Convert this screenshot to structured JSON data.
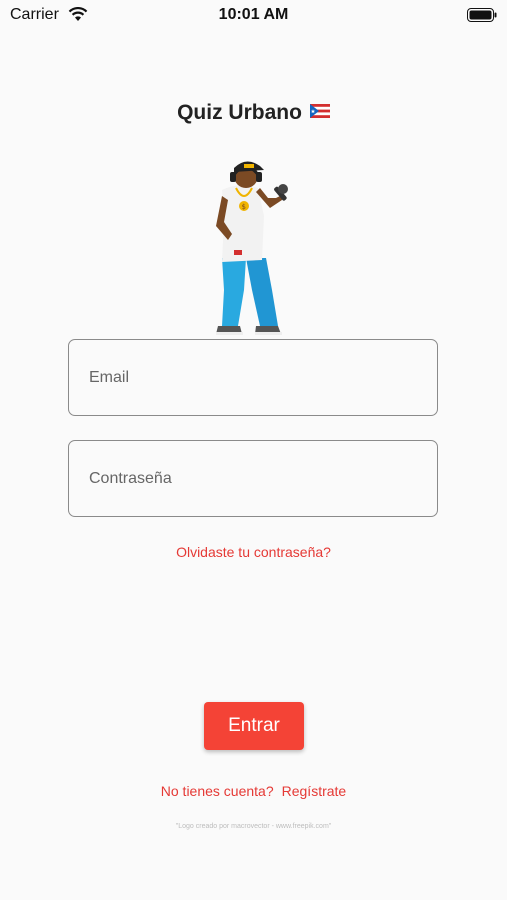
{
  "status_bar": {
    "carrier": "Carrier",
    "time": "10:01 AM"
  },
  "app": {
    "title": "Quiz Urbano"
  },
  "login": {
    "email_placeholder": "Email",
    "password_placeholder": "Contraseña",
    "forgot_label": "Olvidaste tu contraseña?",
    "enter_label": "Entrar",
    "no_account_label": "No tienes cuenta?",
    "register_label": "Regístrate",
    "credit": "\"Logo creado por macrovector - www.freepik.com\""
  },
  "colors": {
    "accent": "#f44336",
    "link": "#e53935",
    "background": "#fafafa",
    "border": "#8a8a8a"
  },
  "icons": {
    "status": [
      "wifi-icon",
      "battery-icon"
    ],
    "title": "puerto-rico-flag-icon",
    "mascot": "rapper-mascot-illustration"
  }
}
